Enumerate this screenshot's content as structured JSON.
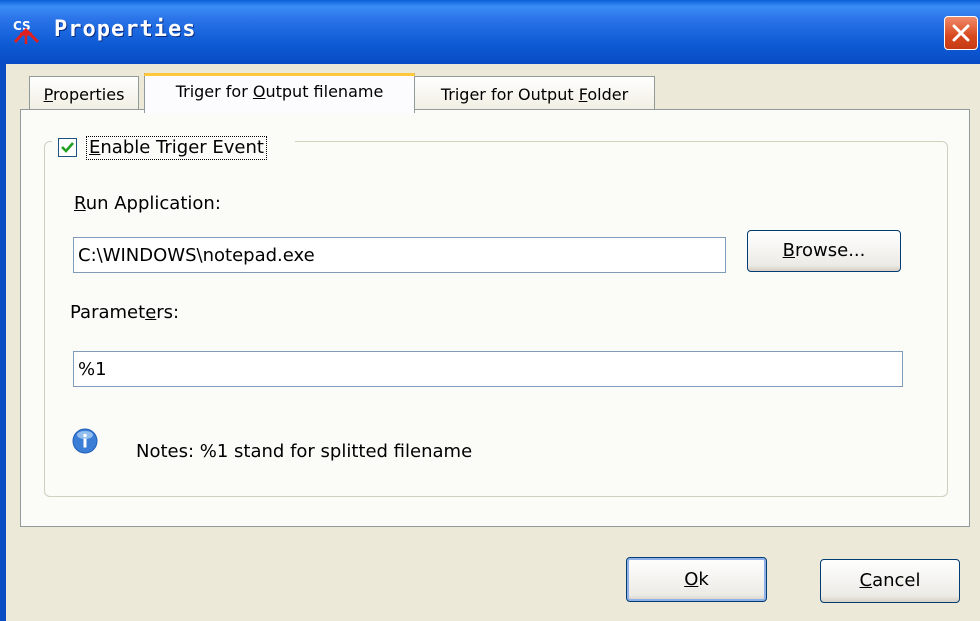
{
  "window": {
    "title": "Properties"
  },
  "tabs": [
    {
      "label": "Properties",
      "active": false,
      "mnemonic_index": 0
    },
    {
      "label": "Triger for Output filename",
      "active": true,
      "mnemonic_index": 11
    },
    {
      "label": "Triger for Output Folder",
      "active": false,
      "mnemonic_index": 18
    }
  ],
  "group": {
    "enable_label": "Enable Triger Event",
    "enable_checked": true,
    "run_application_label": "Run Application:",
    "run_application_value": "C:\\WINDOWS\\notepad.exe",
    "browse_label": "Browse...",
    "parameters_label": "Parameters:",
    "parameters_value": "%1",
    "notes_text": "Notes: %1 stand for splitted filename"
  },
  "footer": {
    "ok_label": "Ok",
    "cancel_label": "Cancel"
  },
  "icons": {
    "app": "split-app-icon",
    "close": "close-icon",
    "check": "checkmark-icon",
    "info": "info-icon"
  },
  "colors": {
    "titlebar": "#0a5fd8",
    "close": "#d8481e",
    "active_tab_highlight": "#ffc83c",
    "check": "#21a121",
    "info": "#3b7ed6"
  }
}
